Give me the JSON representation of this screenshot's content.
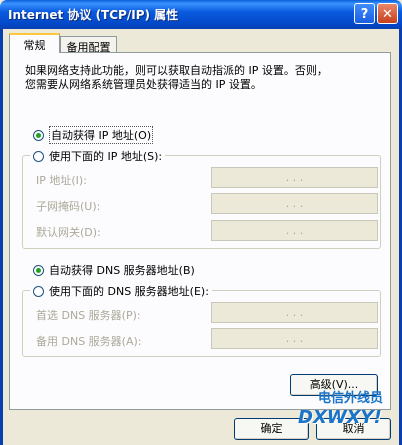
{
  "window": {
    "title": "Internet 协议 (TCP/IP) 属性",
    "help_glyph": "?",
    "close_glyph": "✕"
  },
  "tabs": [
    {
      "label": "常规",
      "active": true
    },
    {
      "label": "备用配置",
      "active": false
    }
  ],
  "description": [
    "如果网络支持此功能，则可以获取自动指派的 IP 设置。否则，",
    "您需要从网络系统管理员处获得适当的 IP 设置。"
  ],
  "ip_section": {
    "auto_label": "自动获得 IP 地址(O)",
    "auto_checked": true,
    "manual_label": "使用下面的 IP 地址(S):",
    "manual_checked": false,
    "fields": [
      {
        "label": "IP 地址(I):",
        "value": ". . ."
      },
      {
        "label": "子网掩码(U):",
        "value": ". . ."
      },
      {
        "label": "默认网关(D):",
        "value": ". . ."
      }
    ]
  },
  "dns_section": {
    "auto_label": "自动获得 DNS 服务器地址(B)",
    "auto_checked": true,
    "manual_label": "使用下面的 DNS 服务器地址(E):",
    "manual_checked": false,
    "fields": [
      {
        "label": "首选 DNS 服务器(P):",
        "value": ". . ."
      },
      {
        "label": "备用 DNS 服务器(A):",
        "value": ". . ."
      }
    ]
  },
  "buttons": {
    "advanced": "高级(V)...",
    "ok": "确定",
    "cancel": "取消"
  },
  "watermark": {
    "text_cn": "电信外线员",
    "text_en": "DXWXY!"
  },
  "colors": {
    "titlebar": "#0147c6",
    "dialog_bg": "#ece9d8",
    "radio_checked": "#21a121",
    "disabled_text": "#aca899"
  }
}
